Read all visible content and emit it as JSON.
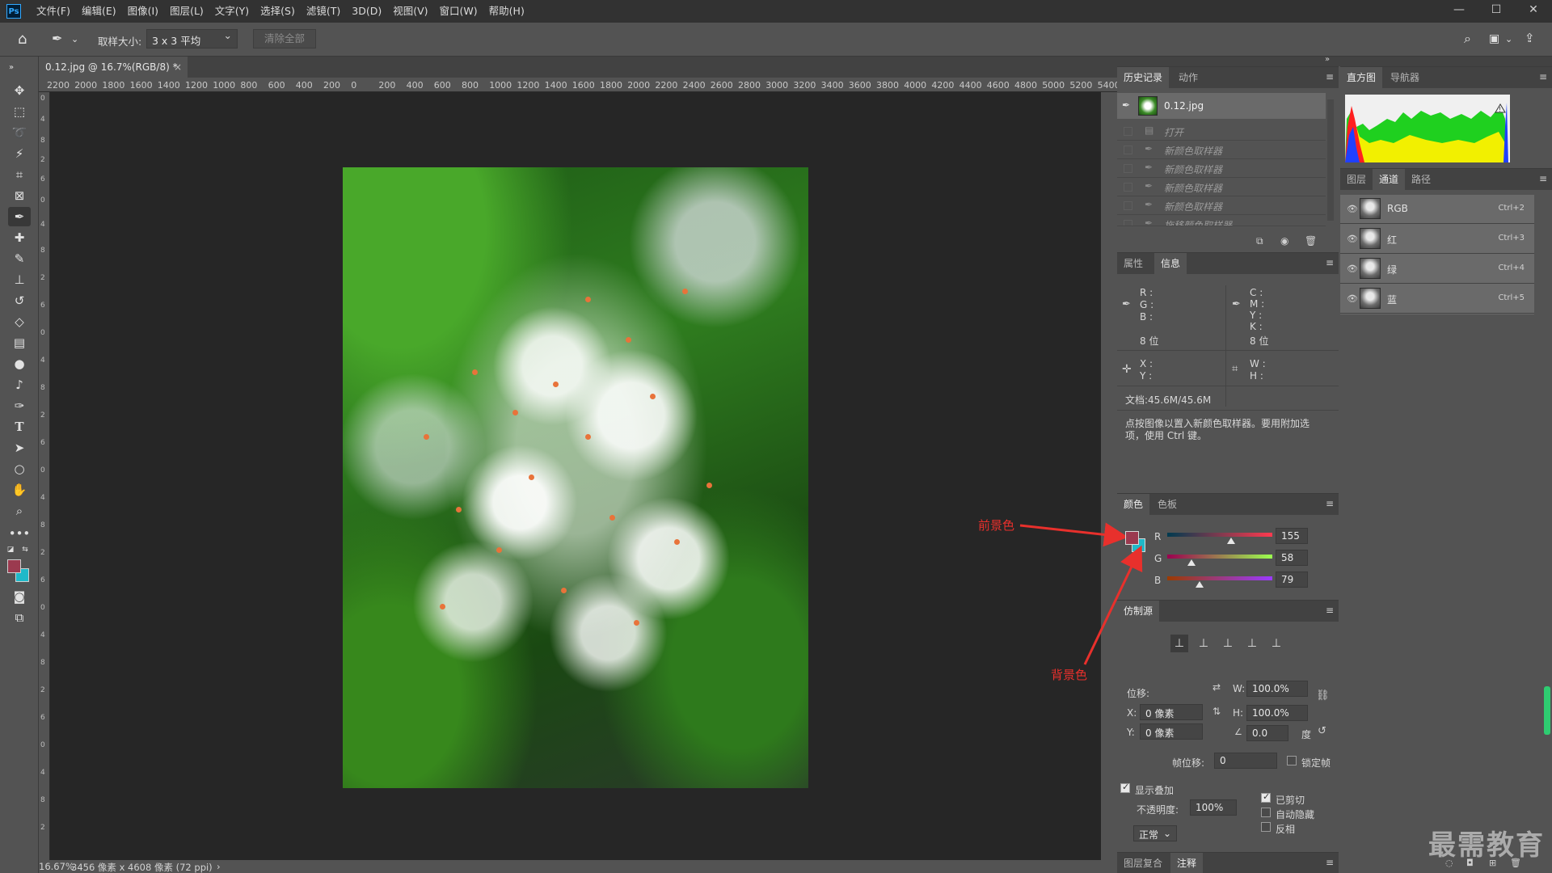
{
  "app": {
    "logo": "Ps"
  },
  "menu": [
    "文件(F)",
    "编辑(E)",
    "图像(I)",
    "图层(L)",
    "文字(Y)",
    "选择(S)",
    "滤镜(T)",
    "3D(D)",
    "视图(V)",
    "窗口(W)",
    "帮助(H)"
  ],
  "window_controls": {
    "minimize": "—",
    "maximize": "☐",
    "close": "✕"
  },
  "options": {
    "sample_label": "取样大小:",
    "sample_value": "3 x 3 平均",
    "clear_all": "清除全部"
  },
  "document": {
    "tab_title": "0.12.jpg @ 16.7%(RGB/8) *",
    "close": "×"
  },
  "ruler_h": [
    "2200",
    "2000",
    "1800",
    "1600",
    "1400",
    "1200",
    "1000",
    "800",
    "600",
    "400",
    "200",
    "0",
    "200",
    "400",
    "600",
    "800",
    "1000",
    "1200",
    "1400",
    "1600",
    "1800",
    "2000",
    "2200",
    "2400",
    "2600",
    "2800",
    "3000",
    "3200",
    "3400",
    "3600",
    "3800",
    "4000",
    "4200",
    "4400",
    "4600",
    "4800",
    "5000",
    "5200",
    "5400"
  ],
  "status": {
    "zoom": "16.67%",
    "size": "3456 像素 x 4608 像素 (72 ppi)",
    "arrow": "›"
  },
  "history_panel": {
    "tabs": [
      "历史记录",
      "动作"
    ],
    "snapshot": "0.12.jpg",
    "items": [
      "打开",
      "新颜色取样器",
      "新颜色取样器",
      "新颜色取样器",
      "新颜色取样器",
      "拖移颜色取样器"
    ]
  },
  "histogram_panel": {
    "tabs": [
      "直方图",
      "导航器"
    ]
  },
  "channels_panel": {
    "tabs": [
      "图层",
      "通道",
      "路径"
    ],
    "channels": [
      {
        "name": "RGB",
        "shortcut": "Ctrl+2"
      },
      {
        "name": "红",
        "shortcut": "Ctrl+3"
      },
      {
        "name": "绿",
        "shortcut": "Ctrl+4"
      },
      {
        "name": "蓝",
        "shortcut": "Ctrl+5"
      }
    ]
  },
  "info_panel": {
    "tabs": [
      "属性",
      "信息"
    ],
    "rgb_labels": "R :\nG :\nB :",
    "cmyk_labels": "C :\nM :\nY :\nK :",
    "bits_left": "8 位",
    "bits_right": "8 位",
    "xy_labels": "X :\nY :",
    "wh_labels": "W :\nH :",
    "doc_size": "文档:45.6M/45.6M",
    "hint": "点按图像以置入新颜色取样器。要用附加选项，使用 Ctrl 键。"
  },
  "color_panel": {
    "tabs": [
      "颜色",
      "色板"
    ],
    "channels": [
      {
        "label": "R",
        "value": "155",
        "level": 0.608
      },
      {
        "label": "G",
        "value": "58",
        "level": 0.227
      },
      {
        "label": "B",
        "value": "79",
        "level": 0.31
      }
    ],
    "foreground": "#9b3a4f",
    "background": "#1fb9c9"
  },
  "clone_panel": {
    "tabs": [
      "仿制源"
    ],
    "offset_label": "位移:",
    "w_label": "W:",
    "w_value": "100.0%",
    "h_label": "H:",
    "h_value": "100.0%",
    "x_label": "X:",
    "x_value": "0 像素",
    "y_label": "Y:",
    "y_value": "0 像素",
    "angle_value": "0.0",
    "angle_unit": "度",
    "frame_offset_label": "帧位移:",
    "frame_offset_value": "0",
    "lock_frame": "锁定帧",
    "show_overlay": "显示叠加",
    "opacity_label": "不透明度:",
    "opacity_value": "100%",
    "clipped": "已剪切",
    "auto_hide": "自动隐藏",
    "invert": "反相",
    "blend_mode": "正常"
  },
  "bottom_tabs": [
    "图层复合",
    "注释"
  ],
  "annotations": {
    "foreground": "前景色",
    "background": "背景色"
  },
  "watermark": "最需教育"
}
